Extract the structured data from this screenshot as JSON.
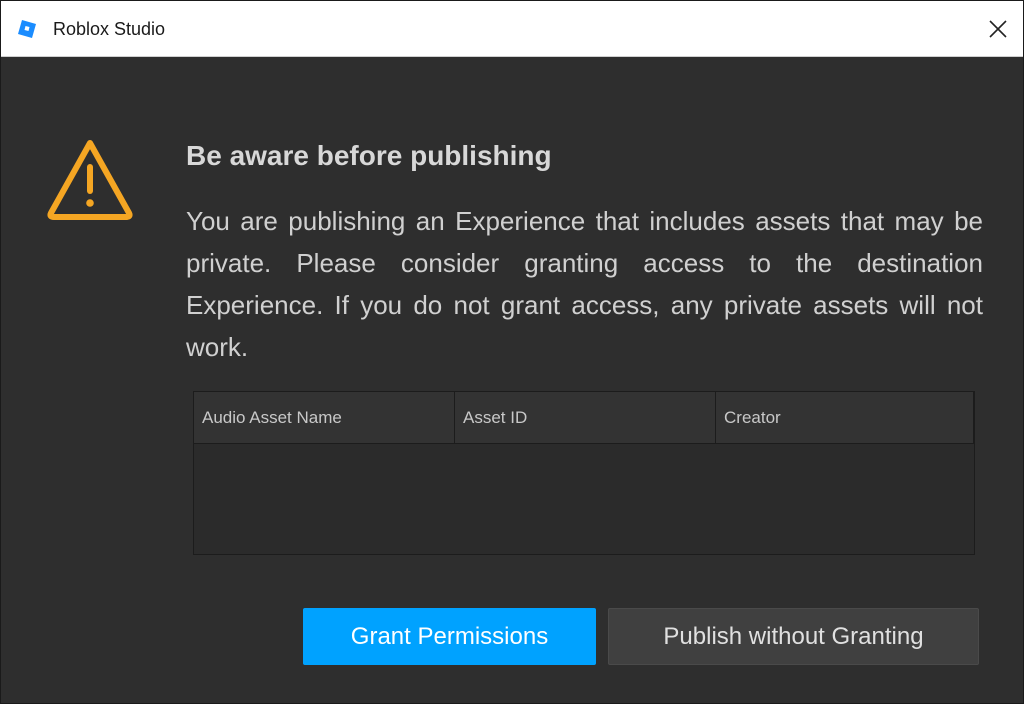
{
  "window": {
    "title": "Roblox Studio"
  },
  "dialog": {
    "heading": "Be aware before publishing",
    "message": "You are publishing an Experience that includes assets that may be private. Please consider granting access to the destination Experience. If you do not grant access, any private assets will not work."
  },
  "table": {
    "columns": [
      "Audio Asset Name",
      "Asset ID",
      "Creator"
    ],
    "rows": []
  },
  "buttons": {
    "grant": "Grant Permissions",
    "publish": "Publish without Granting"
  },
  "colors": {
    "accent": "#00a2ff",
    "warning": "#f5a623",
    "background": "#2e2e2e"
  }
}
